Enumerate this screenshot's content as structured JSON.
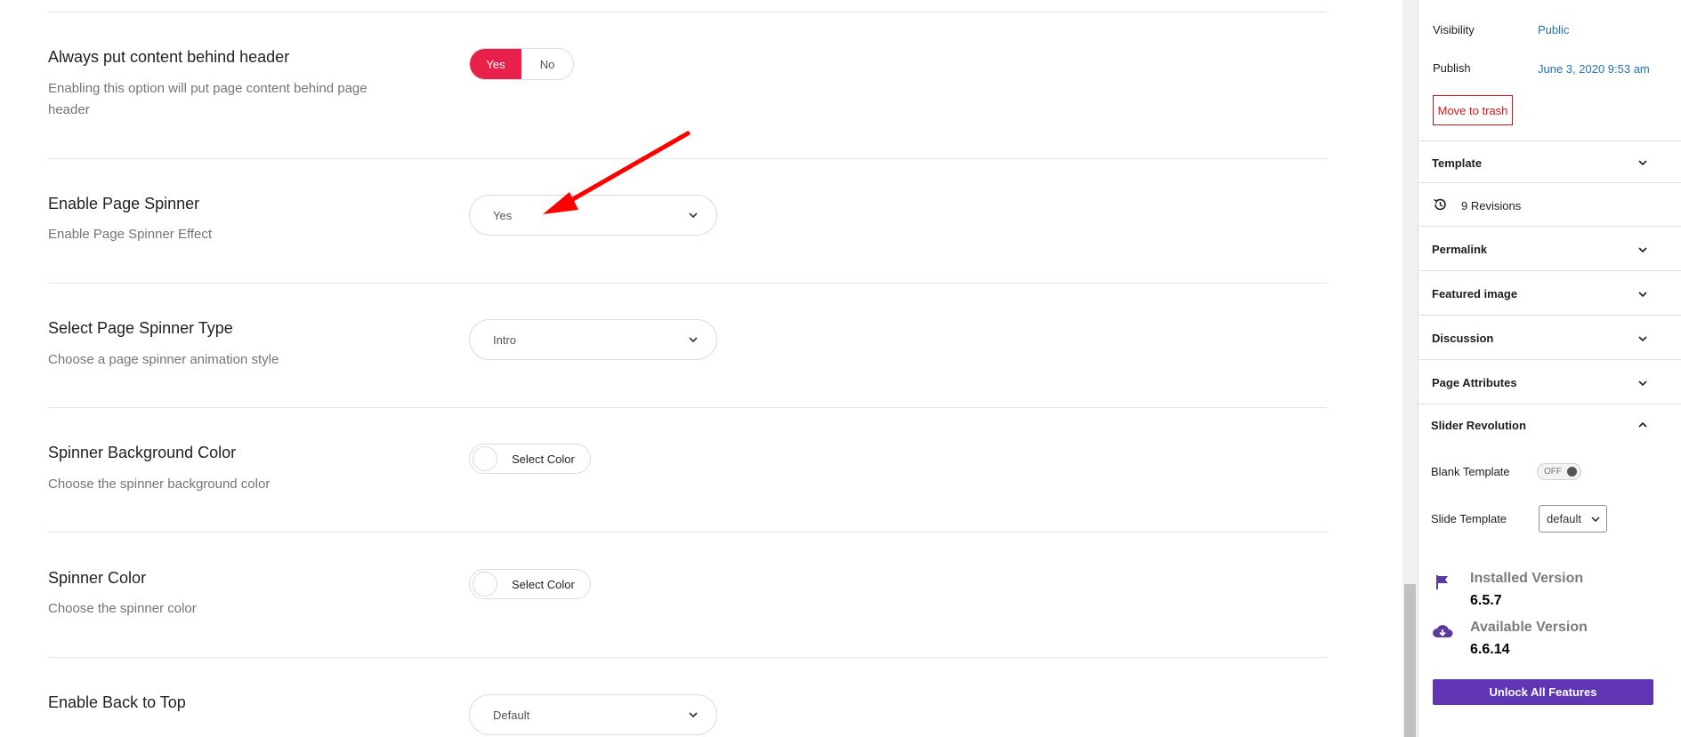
{
  "settings": [
    {
      "title": "Always put content behind header",
      "description": "Enabling this option will put page content behind page header",
      "control": "yesno",
      "options": [
        "Yes",
        "No"
      ],
      "selected": "Yes"
    },
    {
      "title": "Enable Page Spinner",
      "description": "Enable Page Spinner Effect",
      "control": "select",
      "value": "Yes"
    },
    {
      "title": "Select Page Spinner Type",
      "description": "Choose a page spinner animation style",
      "control": "select",
      "value": "Intro"
    },
    {
      "title": "Spinner Background Color",
      "description": "Choose the spinner background color",
      "control": "color",
      "label": "Select Color"
    },
    {
      "title": "Spinner Color",
      "description": "Choose the spinner color",
      "control": "color",
      "label": "Select Color"
    },
    {
      "title": "Enable Back to Top",
      "control": "select",
      "value": "Default"
    }
  ],
  "sidebar": {
    "visibility_label": "Visibility",
    "visibility_value": "Public",
    "publish_label": "Publish",
    "publish_value": "June 3, 2020 9:53 am",
    "trash_label": "Move to trash",
    "template_label": "Template",
    "revisions_label": "9 Revisions",
    "permalink_label": "Permalink",
    "featured_image_label": "Featured image",
    "discussion_label": "Discussion",
    "page_attributes_label": "Page Attributes",
    "slider_revolution": {
      "title": "Slider Revolution",
      "blank_template_label": "Blank Template",
      "toggle_state": "OFF",
      "slide_template_label": "Slide Template",
      "slide_template_value": "default",
      "installed_label": "Installed Version",
      "installed_value": "6.5.7",
      "available_label": "Available Version",
      "available_value": "6.6.14",
      "unlock_label": "Unlock All Features"
    }
  },
  "colors": {
    "accent_red": "#e8214a",
    "link_blue": "#2271b1",
    "trash_red": "#cc1818",
    "slider_purple": "#5f35b4",
    "annotation_arrow": "#ff0000"
  }
}
